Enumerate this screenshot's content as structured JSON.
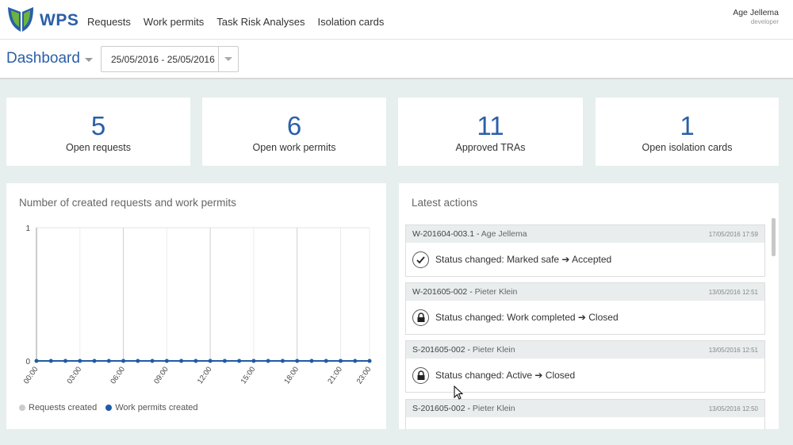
{
  "app": {
    "logo_text": "WPS"
  },
  "nav": {
    "items": [
      "Requests",
      "Work permits",
      "Task Risk Analyses",
      "Isolation cards"
    ]
  },
  "user": {
    "name": "Age Jellema",
    "role": "developer"
  },
  "dashboard": {
    "title": "Dashboard",
    "date_range": "25/05/2016 - 25/05/2016"
  },
  "stats": [
    {
      "value": "5",
      "label": "Open requests"
    },
    {
      "value": "6",
      "label": "Open work permits"
    },
    {
      "value": "11",
      "label": "Approved TRAs"
    },
    {
      "value": "1",
      "label": "Open isolation cards"
    }
  ],
  "chart_panel": {
    "title": "Number of created requests and work permits"
  },
  "chart_data": {
    "type": "line",
    "title": "Number of created requests and work permits",
    "xlabel": "",
    "ylabel": "",
    "ylim": [
      0,
      1
    ],
    "y_ticks": [
      "0",
      "1"
    ],
    "x_tick_labels": [
      "00:00",
      "03:00",
      "06:00",
      "09:00",
      "12:00",
      "15:00",
      "18:00",
      "21:00",
      "23:00"
    ],
    "x": [
      "00:00",
      "01:00",
      "02:00",
      "03:00",
      "04:00",
      "05:00",
      "06:00",
      "07:00",
      "08:00",
      "09:00",
      "10:00",
      "11:00",
      "12:00",
      "13:00",
      "14:00",
      "15:00",
      "16:00",
      "17:00",
      "18:00",
      "19:00",
      "20:00",
      "21:00",
      "22:00",
      "23:00"
    ],
    "series": [
      {
        "name": "Requests created",
        "color": "#cccccc",
        "values": [
          0,
          0,
          0,
          0,
          0,
          0,
          0,
          0,
          0,
          0,
          0,
          0,
          0,
          0,
          0,
          0,
          0,
          0,
          0,
          0,
          0,
          0,
          0,
          0
        ]
      },
      {
        "name": "Work permits created",
        "color": "#1f5ca8",
        "values": [
          0,
          0,
          0,
          0,
          0,
          0,
          0,
          0,
          0,
          0,
          0,
          0,
          0,
          0,
          0,
          0,
          0,
          0,
          0,
          0,
          0,
          0,
          0,
          0
        ]
      }
    ],
    "grid": true,
    "legend": "bottom-left"
  },
  "actions_panel": {
    "title": "Latest actions"
  },
  "actions": [
    {
      "id": "W-201604-003.1",
      "who": "Age Jellema",
      "date": "17/05/2016 17:59",
      "icon": "check-icon",
      "text": "Status changed: Marked safe ➔ Accepted"
    },
    {
      "id": "W-201605-002",
      "who": "Pieter Klein",
      "date": "13/05/2016 12:51",
      "icon": "lock-icon",
      "text": "Status changed: Work completed ➔ Closed"
    },
    {
      "id": "S-201605-002",
      "who": "Pieter Klein",
      "date": "13/05/2016 12:51",
      "icon": "lock-icon",
      "text": "Status changed: Active ➔ Closed"
    },
    {
      "id": "S-201605-002",
      "who": "Pieter Klein",
      "date": "13/05/2016 12:50",
      "icon": "",
      "text": ""
    }
  ],
  "colors": {
    "accent": "#2a5fa8",
    "background": "#e6eeee",
    "logo_green": "#6cb33f"
  }
}
